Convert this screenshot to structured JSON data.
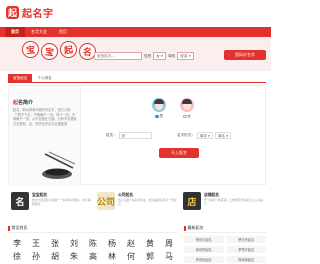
{
  "brand": {
    "mark": "起",
    "name": "起名字",
    "accent": "#e3322b"
  },
  "nav": {
    "items": [
      {
        "label": "首页"
      },
      {
        "label": "名字大全"
      },
      {
        "label": "首页"
      }
    ]
  },
  "hero": {
    "title_chars": [
      "宝",
      "宝",
      "起",
      "名"
    ],
    "surname_placeholder": "宝宝姓氏...",
    "gender_label": "性别",
    "gender_value": "女",
    "option_label": "单双",
    "option_value": "双名",
    "button": "国际好名字"
  },
  "tabs": [
    {
      "label": "宝宝起名"
    },
    {
      "label": "个人测名"
    }
  ],
  "intro": {
    "title_highlight": "起",
    "title_rest": "名简介",
    "body": "起名，看似简单仔细写好名字，但又父母「「镜子下去，不明确于一页」简介一页，不明确于一页，从不见面在方面，分析不清楚就过去是就，名，但完全好名字此更能用"
  },
  "form": {
    "genders": [
      {
        "label": "男",
        "icon": "boy-avatar"
      },
      {
        "label": "女",
        "icon": "girl-avatar"
      }
    ],
    "surname_label": "姓氏：",
    "surname_placeholder": "张",
    "namelen_label": "名字形式：",
    "namelen_value": "单字",
    "namelen_alt": "单名",
    "submit": "马上起名"
  },
  "features": [
    {
      "icon": "名",
      "title": "宝宝起名",
      "desc": "给大大宝宝和小孩起一个好听好听的名，含义解析更好"
    },
    {
      "icon": "公司",
      "title": "公司起名",
      "desc": "给公司起个好名字创业，成为品牌好名字一定好记"
    },
    {
      "icon": "店",
      "title": "店铺起名",
      "desc": "开个好名气的店铺，让你的店开得红红火火好运气"
    }
  ],
  "surnames": {
    "title": "常见姓氏",
    "list": [
      "李",
      "王",
      "张",
      "刘",
      "陈",
      "杨",
      "赵",
      "黄",
      "周",
      "徐",
      "孙",
      "胡",
      "朱",
      "高",
      "林",
      "何",
      "郭",
      "马"
    ]
  },
  "latest": {
    "title": "最新起名",
    "items": [
      "杨欣贝起名",
      "罗红彤起名",
      "杨欣悦起名",
      "罗思汐起名",
      "李欣怡起名",
      "周雨泽起名"
    ]
  }
}
